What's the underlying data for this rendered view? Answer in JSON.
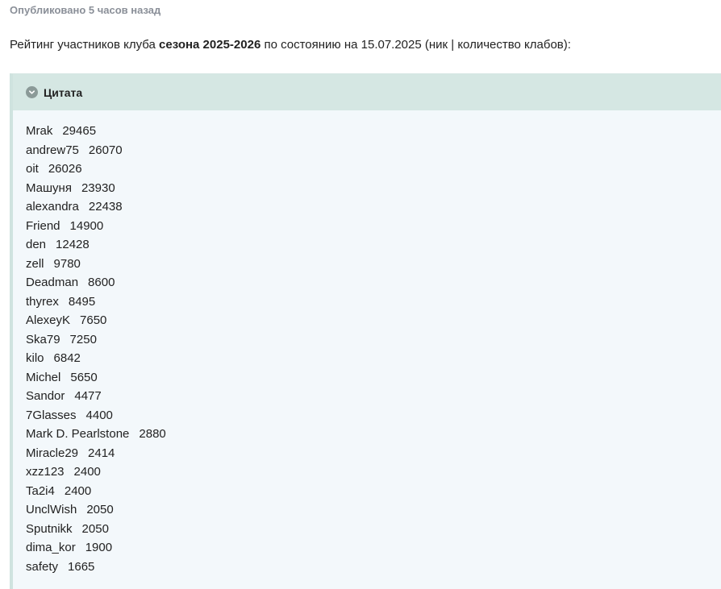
{
  "post": {
    "meta": "Опубликовано 5 часов назад",
    "intro_before": "Рейтинг участников клуба ",
    "intro_bold": "сезона 2025-2026",
    "intro_after": " по состоянию на 15.07.2025 (ник | количество клабов):"
  },
  "quote": {
    "title": "Цитата",
    "toggle_icon": "chevron-down-icon",
    "rows": [
      {
        "nick": "Mrak",
        "count": "29465"
      },
      {
        "nick": "andrew75",
        "count": "26070"
      },
      {
        "nick": "oit",
        "count": "26026"
      },
      {
        "nick": "Машуня",
        "count": "23930"
      },
      {
        "nick": "alexandra",
        "count": "22438"
      },
      {
        "nick": "Friend",
        "count": "14900"
      },
      {
        "nick": "den",
        "count": "12428"
      },
      {
        "nick": "zell",
        "count": "9780"
      },
      {
        "nick": "Deadman",
        "count": "8600"
      },
      {
        "nick": "thyrex",
        "count": "8495"
      },
      {
        "nick": "AlexeyK",
        "count": "7650"
      },
      {
        "nick": "Ska79",
        "count": "7250"
      },
      {
        "nick": "kilo",
        "count": "6842"
      },
      {
        "nick": "Michel",
        "count": "5650"
      },
      {
        "nick": "Sandor",
        "count": "4477"
      },
      {
        "nick": "7Glasses",
        "count": "4400"
      },
      {
        "nick": "Mark D. Pearlstone",
        "count": "2880"
      },
      {
        "nick": "Miracle29",
        "count": "2414"
      },
      {
        "nick": "xzz123",
        "count": "2400"
      },
      {
        "nick": "Ta2i4",
        "count": "2400"
      },
      {
        "nick": "UnclWish",
        "count": "2050"
      },
      {
        "nick": "Sputnikk",
        "count": "2050"
      },
      {
        "nick": "dima_kor",
        "count": "1900"
      },
      {
        "nick": "safety",
        "count": "1665"
      }
    ]
  },
  "colors": {
    "quote_header_bg": "#d5e7e3",
    "quote_body_bg": "#f3f8fb",
    "meta_text": "#8a8f98"
  }
}
